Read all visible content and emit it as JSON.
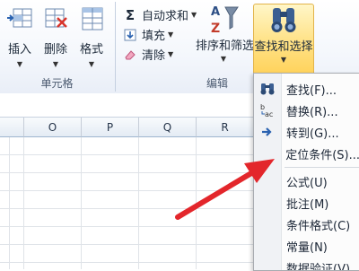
{
  "ribbon": {
    "cells_group": {
      "label": "单元格",
      "insert": "插入",
      "delete": "删除",
      "format": "格式"
    },
    "edit_group": {
      "label": "编辑",
      "autosum": "自动求和",
      "fill": "填充",
      "clear": "清除",
      "sort_filter": "排序和筛选",
      "find_select": "查找和选择"
    }
  },
  "sheet": {
    "columns": [
      "O",
      "P",
      "Q",
      "R"
    ]
  },
  "menu": {
    "items": [
      {
        "label": "查找(F)...",
        "icon": "binoculars-icon"
      },
      {
        "label": "替换(R)...",
        "icon": "replace-icon"
      },
      {
        "label": "转到(G)...",
        "icon": "arrow-right-icon"
      },
      {
        "label": "定位条件(S)...",
        "icon": ""
      },
      {
        "label": "公式(U)",
        "icon": ""
      },
      {
        "label": "批注(M)",
        "icon": ""
      },
      {
        "label": "条件格式(C)",
        "icon": ""
      },
      {
        "label": "常量(N)",
        "icon": ""
      },
      {
        "label": "数据验证(V)",
        "icon": ""
      }
    ]
  },
  "colors": {
    "highlight": "#ffe59a",
    "annotation_arrow": "#e3262b"
  }
}
